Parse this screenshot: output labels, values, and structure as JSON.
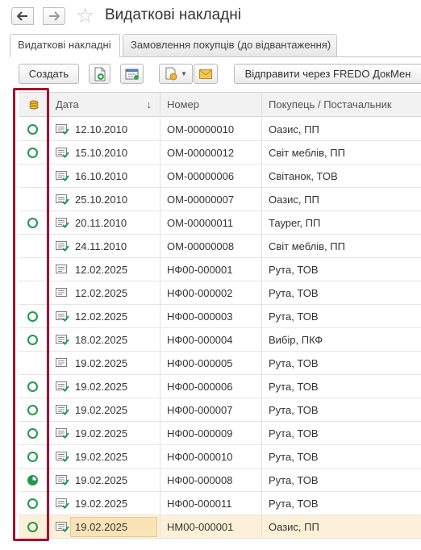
{
  "window": {
    "title": "Видаткові накладні"
  },
  "tabs": [
    {
      "label": "Видаткові накладні"
    },
    {
      "label": "Замовлення покупців (до відвантаження)"
    }
  ],
  "toolbar": {
    "create_label": "Создать",
    "send_label": "Відправити через FREDO ДокМен"
  },
  "columns": {
    "date": "Дата",
    "number": "Номер",
    "customer": "Покупець / Постачальник",
    "sort_icon": "↓"
  },
  "colors": {
    "status_green": "#1d9a4a",
    "highlight_frame": "#a4122c",
    "selected_row": "#fdf0d8"
  },
  "rows": [
    {
      "status": "done",
      "posted": true,
      "date": "12.10.2010",
      "number": "ОМ-00000010",
      "customer": "Оазис, ПП"
    },
    {
      "status": "done",
      "posted": true,
      "date": "15.10.2010",
      "number": "ОМ-00000012",
      "customer": "Світ меблів, ПП"
    },
    {
      "status": "none",
      "posted": true,
      "date": "16.10.2010",
      "number": "ОМ-00000006",
      "customer": "Світанок, ТОВ"
    },
    {
      "status": "none",
      "posted": true,
      "date": "25.10.2010",
      "number": "ОМ-00000007",
      "customer": "Оазис, ПП"
    },
    {
      "status": "done",
      "posted": true,
      "date": "20.11.2010",
      "number": "ОМ-00000011",
      "customer": "Таурег, ПП"
    },
    {
      "status": "none",
      "posted": true,
      "date": "24.11.2010",
      "number": "ОМ-00000008",
      "customer": "Світ меблів, ПП"
    },
    {
      "status": "none",
      "posted": false,
      "date": "12.02.2025",
      "number": "НФ00-000001",
      "customer": "Рута, ТОВ"
    },
    {
      "status": "none",
      "posted": false,
      "date": "12.02.2025",
      "number": "НФ00-000002",
      "customer": "Рута, ТОВ"
    },
    {
      "status": "done",
      "posted": true,
      "date": "12.02.2025",
      "number": "НФ00-000003",
      "customer": "Рута, ТОВ"
    },
    {
      "status": "done",
      "posted": true,
      "date": "18.02.2025",
      "number": "НФ00-000004",
      "customer": "Вибір, ПКФ"
    },
    {
      "status": "none",
      "posted": false,
      "date": "19.02.2025",
      "number": "НФ00-000005",
      "customer": "Рута, ТОВ"
    },
    {
      "status": "done",
      "posted": true,
      "date": "19.02.2025",
      "number": "НФ00-000006",
      "customer": "Рута, ТОВ"
    },
    {
      "status": "done",
      "posted": true,
      "date": "19.02.2025",
      "number": "НФ00-000007",
      "customer": "Рута, ТОВ"
    },
    {
      "status": "done",
      "posted": true,
      "date": "19.02.2025",
      "number": "НФ00-000009",
      "customer": "Рута, ТОВ"
    },
    {
      "status": "done",
      "posted": true,
      "date": "19.02.2025",
      "number": "НФ00-000010",
      "customer": "Рута, ТОВ"
    },
    {
      "status": "partial",
      "posted": true,
      "date": "19.02.2025",
      "number": "НФ00-000008",
      "customer": "Рута, ТОВ"
    },
    {
      "status": "done",
      "posted": true,
      "date": "19.02.2025",
      "number": "НФ00-000011",
      "customer": "Рута, ТОВ"
    },
    {
      "status": "done",
      "posted": true,
      "date": "19.02.2025",
      "number": "НМ00-000001",
      "customer": "Оазис, ПП",
      "selected": true
    }
  ]
}
